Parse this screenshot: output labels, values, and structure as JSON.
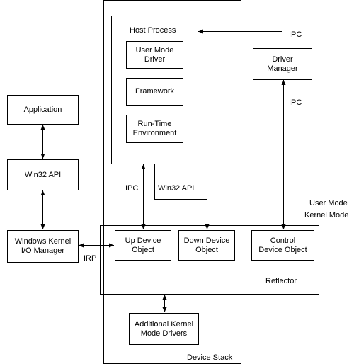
{
  "nodes": {
    "host_process": "Host Process",
    "user_mode_driver": "User Mode\nDriver",
    "framework": "Framework",
    "runtime": "Run-Time\nEnvironment",
    "driver_manager": "Driver\nManager",
    "application": "Application",
    "win32_api": "Win32 API",
    "io_manager": "Windows Kernel\nI/O Manager",
    "up_device": "Up Device\nObject",
    "down_device": "Down Device\nObject",
    "control_device": "Control\nDevice Object",
    "additional_drivers": "Additional Kernel\nMode Drivers",
    "reflector": "Reflector",
    "device_stack": "Device Stack"
  },
  "labels": {
    "ipc_host_dm": "IPC",
    "ipc_dm_control": "IPC",
    "ipc_host_up": "IPC",
    "win32_host_down": "Win32 API",
    "irp": "IRP",
    "user_mode": "User Mode",
    "kernel_mode": "Kernel Mode"
  }
}
